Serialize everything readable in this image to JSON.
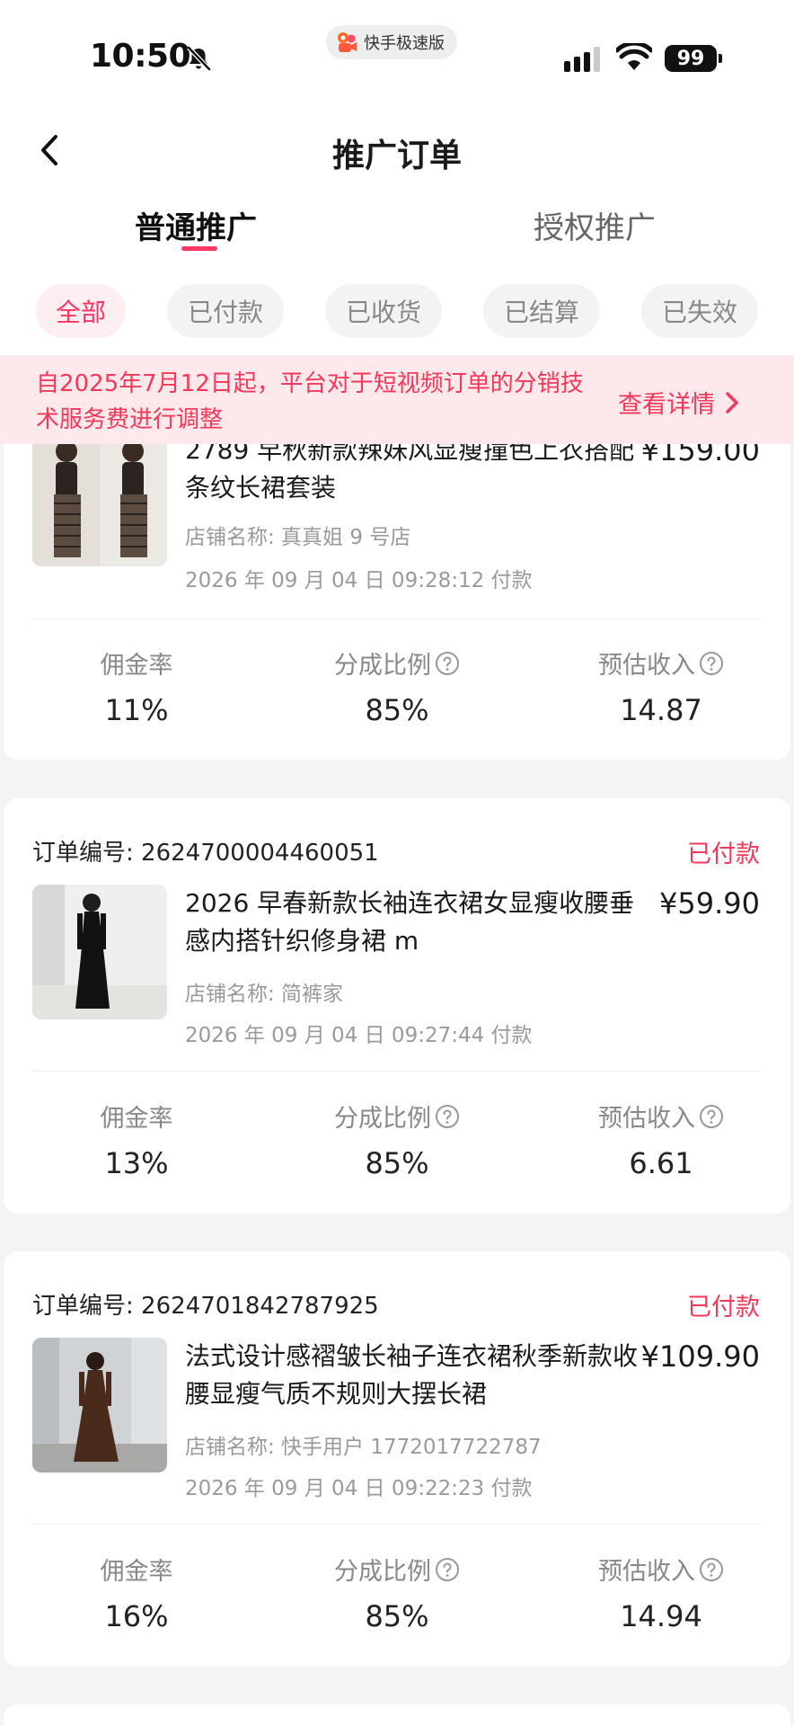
{
  "status_bar": {
    "time": "10:50",
    "app_name": "快手极速版",
    "battery": "99"
  },
  "header": {
    "title": "推广订单"
  },
  "tabs": [
    {
      "label": "普通推广",
      "active": true
    },
    {
      "label": "授权推广",
      "active": false
    }
  ],
  "filters": [
    {
      "label": "全部",
      "active": true
    },
    {
      "label": "已付款",
      "active": false
    },
    {
      "label": "已收货",
      "active": false
    },
    {
      "label": "已结算",
      "active": false
    },
    {
      "label": "已失效",
      "active": false
    }
  ],
  "notice": {
    "text": "自2025年7月12日起，平台对于短视频订单的分销技术服务费进行调整",
    "link_label": "查看详情"
  },
  "stat_labels": {
    "commission_rate": "佣金率",
    "share_ratio": "分成比例",
    "estimated_income": "预估收入"
  },
  "orders": [
    {
      "order_no_label": "",
      "order_no": "",
      "status": "",
      "title": "2789 早秋新款辣妹风显瘦撞色上衣搭配条纹长裙套装",
      "price": "¥159.00",
      "shop": "店铺名称: 真真姐 9 号店",
      "pay_time": "2026 年 09 月 04 日 09:28:12 付款",
      "commission_rate": "11%",
      "share_ratio": "85%",
      "estimated_income": "14.87"
    },
    {
      "order_no_label": "订单编号:",
      "order_no": "2624700004460051",
      "status": "已付款",
      "title": "2026 早春新款长袖连衣裙女显瘦收腰垂感内搭针织修身裙 m",
      "price": "¥59.90",
      "shop": "店铺名称: 简裤家",
      "pay_time": "2026 年 09 月 04 日 09:27:44 付款",
      "commission_rate": "13%",
      "share_ratio": "85%",
      "estimated_income": "6.61"
    },
    {
      "order_no_label": "订单编号:",
      "order_no": "2624701842787925",
      "status": "已付款",
      "title": "法式设计感褶皱长袖子连衣裙秋季新款收腰显瘦气质不规则大摆长裙",
      "price": "¥109.90",
      "shop": "店铺名称: 快手用户 1772017722787",
      "pay_time": "2026 年 09 月 04 日 09:22:23 付款",
      "commission_rate": "16%",
      "share_ratio": "85%",
      "estimated_income": "14.94"
    }
  ],
  "colors": {
    "accent": "#fe3666",
    "notice_bg": "#fde8ec",
    "page_bg": "#f4f4f6"
  }
}
